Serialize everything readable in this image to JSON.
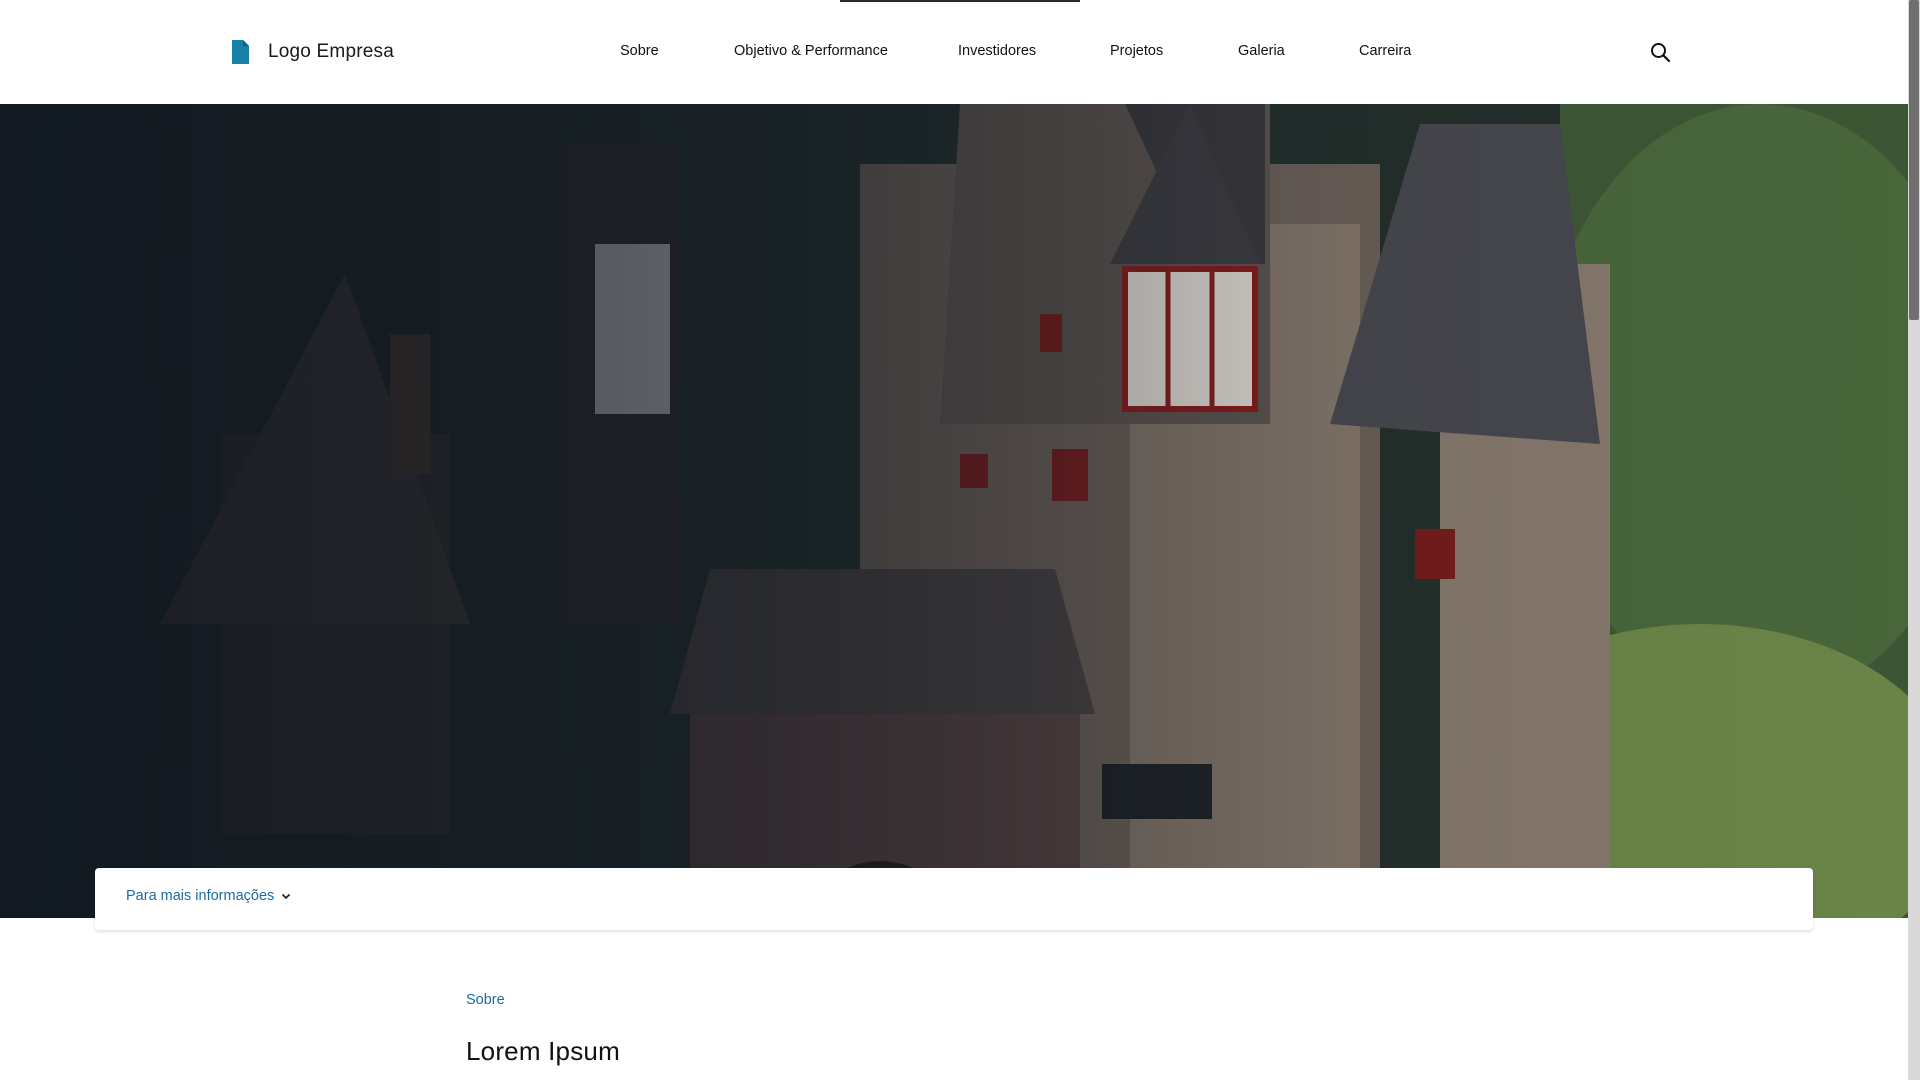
{
  "header": {
    "logo_text": "Logo Empresa",
    "logo_icon": "document-icon",
    "logo_color": "#1a7fa6",
    "search_icon": "search-icon"
  },
  "nav": {
    "items": [
      {
        "label": "Sobre"
      },
      {
        "label": "Objetivo & Performance"
      },
      {
        "label": "Investidores"
      },
      {
        "label": "Projetos"
      },
      {
        "label": "Galeria"
      },
      {
        "label": "Carreira"
      }
    ],
    "active_index": 1
  },
  "hero": {
    "image": "castle-photo"
  },
  "info_bar": {
    "label": "Para mais informações",
    "icon": "chevron-down-icon"
  },
  "content": {
    "breadcrumb": "Sobre",
    "title": "Lorem Ipsum"
  },
  "colors": {
    "accent": "#1d6aa3",
    "text": "#111111"
  }
}
